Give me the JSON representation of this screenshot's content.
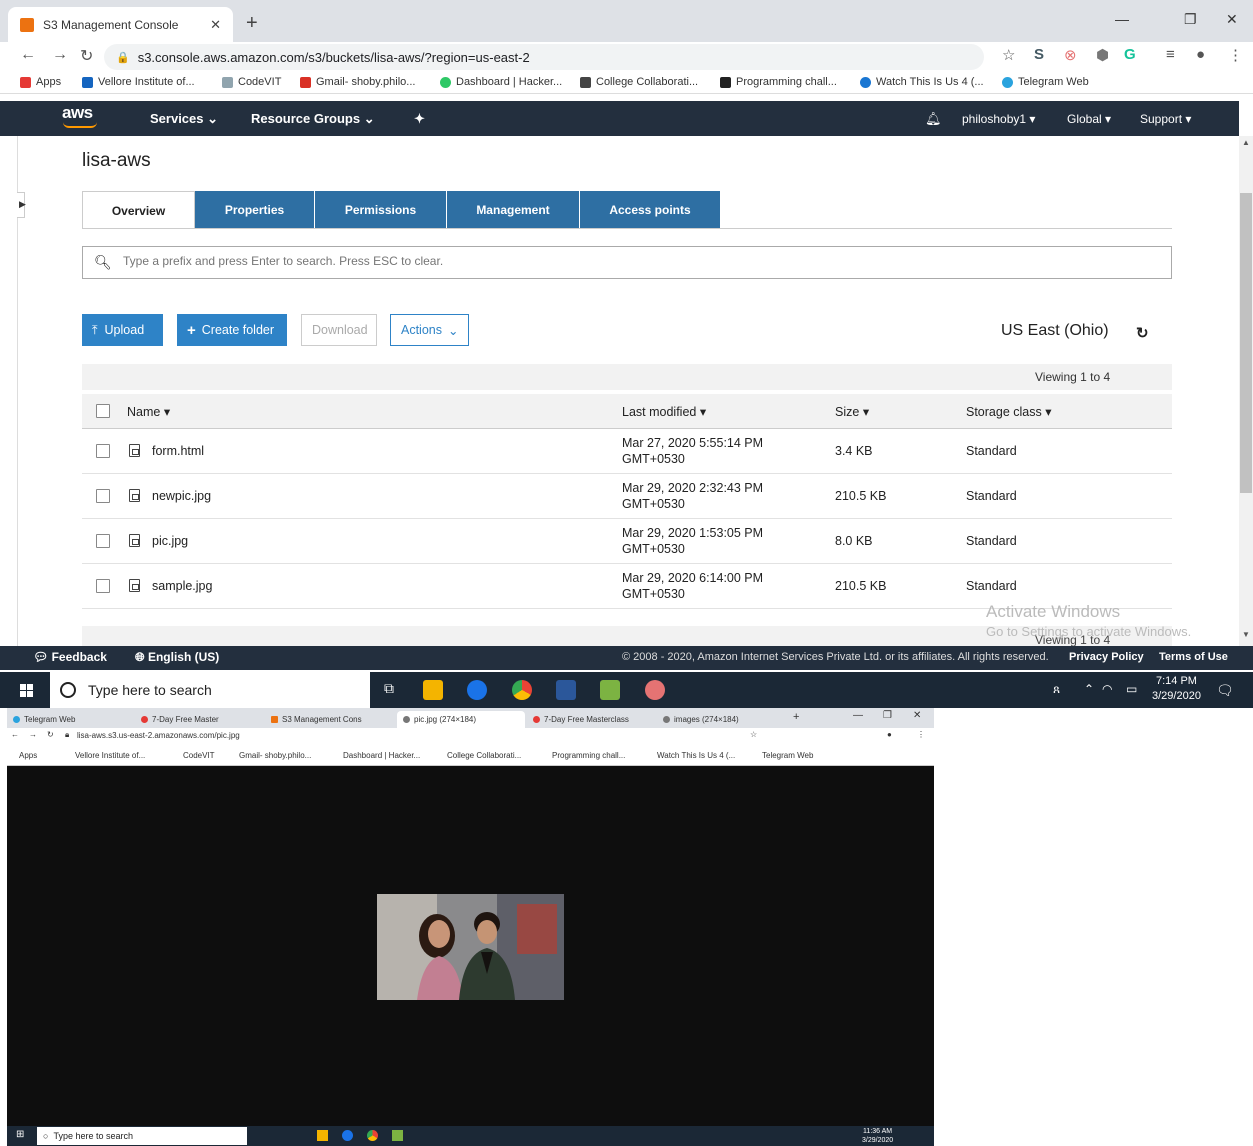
{
  "browser": {
    "tab_title": "S3 Management Console",
    "url": "s3.console.aws.amazon.com/s3/buckets/lisa-aws/?region=us-east-2",
    "bookmarks": [
      "Apps",
      "Vellore Institute of...",
      "CodeVIT",
      "Gmail- shoby.philo...",
      "Dashboard | Hacker...",
      "College Collaborati...",
      "Programming chall...",
      "Watch This Is Us 4 (...",
      "Telegram Web"
    ]
  },
  "aws_nav": {
    "logo": "aws",
    "services": "Services",
    "resource_groups": "Resource Groups",
    "user": "philoshoby1",
    "region_menu": "Global",
    "support": "Support"
  },
  "bucket": {
    "name": "lisa-aws",
    "tabs": [
      "Overview",
      "Properties",
      "Permissions",
      "Management",
      "Access points"
    ],
    "search_placeholder": "Type a prefix and press Enter to search. Press ESC to clear.",
    "buttons": {
      "upload": "Upload",
      "create_folder": "Create folder",
      "download": "Download",
      "actions": "Actions"
    },
    "region": "US East (Ohio)",
    "viewing": "Viewing 1 to 4",
    "columns": {
      "name": "Name",
      "last_modified": "Last modified",
      "size": "Size",
      "storage_class": "Storage class"
    },
    "objects": [
      {
        "name": "form.html",
        "date": "Mar 27, 2020 5:55:14 PM",
        "tz": "GMT+0530",
        "size": "3.4 KB",
        "class": "Standard"
      },
      {
        "name": "newpic.jpg",
        "date": "Mar 29, 2020 2:32:43 PM",
        "tz": "GMT+0530",
        "size": "210.5 KB",
        "class": "Standard"
      },
      {
        "name": "pic.jpg",
        "date": "Mar 29, 2020 1:53:05 PM",
        "tz": "GMT+0530",
        "size": "8.0 KB",
        "class": "Standard"
      },
      {
        "name": "sample.jpg",
        "date": "Mar 29, 2020 6:14:00 PM",
        "tz": "GMT+0530",
        "size": "210.5 KB",
        "class": "Standard"
      }
    ],
    "viewing_bottom": "Viewing 1 to 4"
  },
  "watermark": {
    "title": "Activate Windows",
    "sub": "Go to Settings to activate Windows."
  },
  "aws_footer": {
    "feedback": "Feedback",
    "language": "English (US)",
    "copyright": "© 2008 - 2020, Amazon Internet Services Private Ltd. or its affiliates. All rights reserved.",
    "privacy": "Privacy Policy",
    "terms": "Terms of Use"
  },
  "taskbar": {
    "search_placeholder": "Type here to search",
    "time": "7:14 PM",
    "date": "3/29/2020"
  },
  "second_window": {
    "tabs": [
      "Telegram Web",
      "7-Day Free Master",
      "S3 Management Cons",
      "pic.jpg (274×184)",
      "7-Day Free Masterclass",
      "images (274×184)"
    ],
    "url": "lisa-aws.s3.us-east-2.amazonaws.com/pic.jpg",
    "bookmarks": [
      "Apps",
      "Vellore Institute of...",
      "CodeVIT",
      "Gmail- shoby.philo...",
      "Dashboard | Hacker...",
      "College Collaborati...",
      "Programming chall...",
      "Watch This Is Us 4 (...",
      "Telegram Web"
    ],
    "taskbar_search": "Type here to search",
    "time": "11:36 AM",
    "date": "3/29/2020"
  },
  "colors": {
    "aws_nav": "#232f3e",
    "tab_blue": "#2e6fa3",
    "button_blue": "#2e83c7",
    "aws_orange": "#ff9900"
  }
}
